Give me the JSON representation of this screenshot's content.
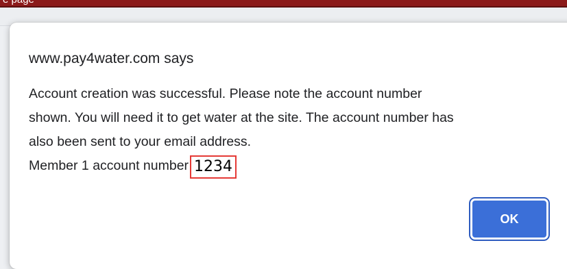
{
  "page": {
    "top_bar_text": "e page"
  },
  "dialog": {
    "title": "www.pay4water.com says",
    "message_lines": [
      "Account creation was successful. Please note the account number",
      "shown. You will need it to get water at the site. The account number has",
      "also been sent to your email address."
    ],
    "account_label": "Member 1 account number",
    "account_number": "1234",
    "ok_label": "OK"
  },
  "colors": {
    "top_bar": "#8b1a1a",
    "highlight_border": "#e53935",
    "ok_button": "#3b6fd8"
  }
}
